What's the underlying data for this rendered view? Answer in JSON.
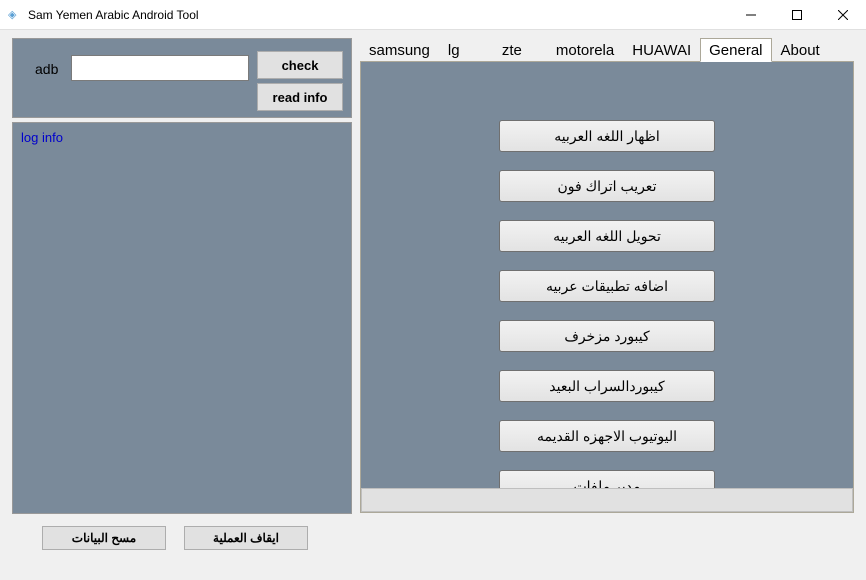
{
  "window": {
    "title": "Sam Yemen Arabic Android Tool"
  },
  "adb": {
    "label": "adb",
    "input_value": "",
    "check_label": "check",
    "readinfo_label": "read info"
  },
  "log": {
    "label": "log info"
  },
  "bottom": {
    "clear_data": "مسح البيانات",
    "stop_process": "ايقاف العملية"
  },
  "tabs": [
    {
      "label": "samsung",
      "active": false
    },
    {
      "label": "lg",
      "active": false
    },
    {
      "label": "zte",
      "active": false
    },
    {
      "label": "motorela",
      "active": false
    },
    {
      "label": "HUAWAI",
      "active": false
    },
    {
      "label": "General",
      "active": true
    },
    {
      "label": "About",
      "active": false
    }
  ],
  "general_actions": {
    "show_arabic": "اظهار اللغه العربيه",
    "arabize_trackphone": "تعريب اتراك فون",
    "convert_arabic": "تحويل اللغه العربيه",
    "add_arabic_apps": "اضافه تطبيقات عربيه",
    "decorated_keyboard": "كيبورد مزخرف",
    "sarab_keyboard": "كيبوردالسراب البعيد",
    "youtube_old": "اليوتيوب الاجهزه القديمه",
    "file_manager": "مدير ملفات"
  }
}
